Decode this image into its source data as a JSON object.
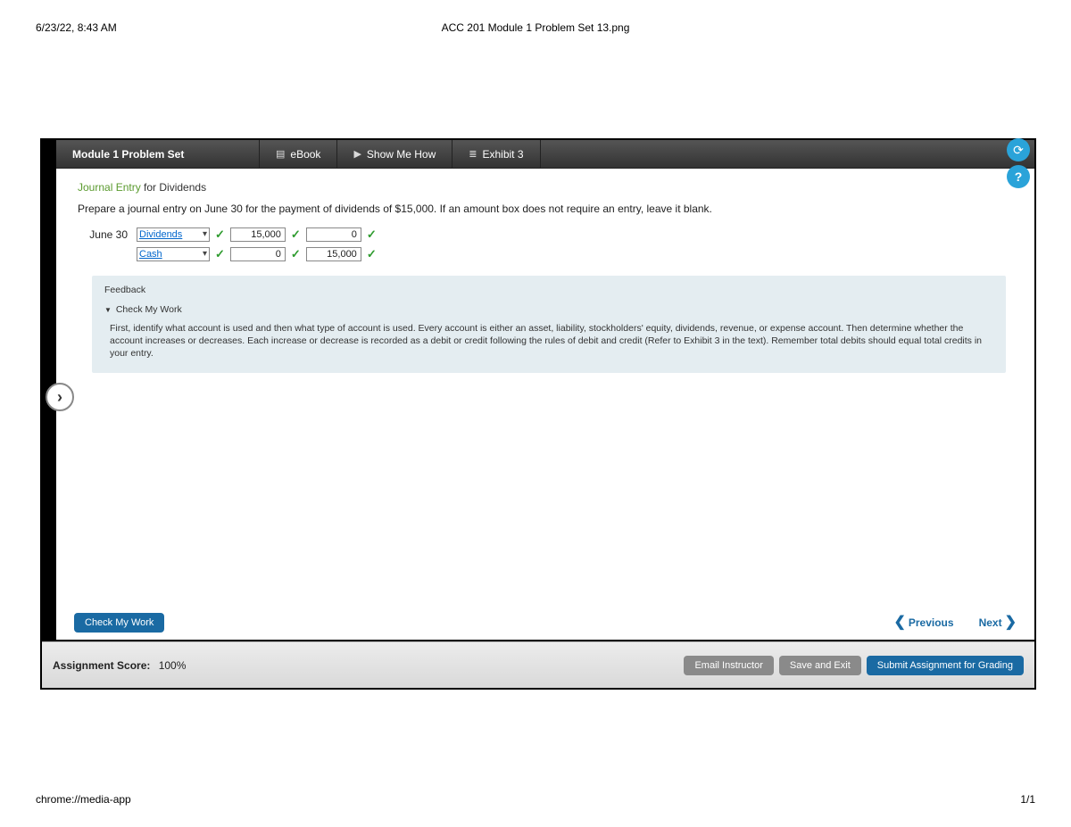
{
  "print_header": {
    "timestamp": "6/23/22, 8:43 AM",
    "filename": "ACC 201 Module 1 Problem Set 13.png"
  },
  "print_footer": {
    "url": "chrome://media-app",
    "page": "1/1"
  },
  "toolbar": {
    "title": "Module 1 Problem Set",
    "ebook": "eBook",
    "show_me_how": "Show Me How",
    "exhibit": "Exhibit 3"
  },
  "section": {
    "title_green": "Journal Entry",
    "title_rest": " for Dividends",
    "instruction": "Prepare a journal entry on June 30 for the payment of dividends of $15,000. If an amount box does not require an entry, leave it blank."
  },
  "journal": {
    "date": "June 30",
    "rows": [
      {
        "account": "Dividends",
        "debit": "15,000",
        "credit": "0"
      },
      {
        "account": "Cash",
        "debit": "0",
        "credit": "15,000"
      }
    ]
  },
  "feedback": {
    "heading": "Feedback",
    "toggle": "Check My Work",
    "body": "First, identify what account is used and then what type of account is used. Every account is either an asset, liability, stockholders' equity, dividends, revenue, or expense account. Then determine whether the account increases or decreases. Each increase or decrease is recorded as a debit or credit following the rules of debit and credit (Refer to Exhibit 3 in the text). Remember total debits should equal total credits in your entry."
  },
  "nav": {
    "check_btn": "Check My Work",
    "previous": "Previous",
    "next": "Next"
  },
  "status": {
    "score_label": "Assignment Score:",
    "score_value": "100%",
    "email": "Email Instructor",
    "save": "Save and Exit",
    "submit": "Submit Assignment for Grading"
  }
}
